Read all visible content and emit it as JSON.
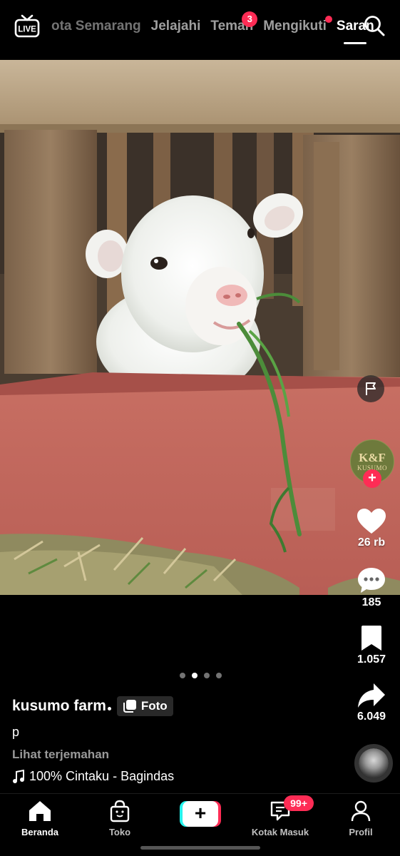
{
  "top_nav": {
    "live_label": "LIVE",
    "tabs": [
      {
        "label": "ota Semarang"
      },
      {
        "label": "Jelajahi"
      },
      {
        "label": "Teman",
        "badge": "3"
      },
      {
        "label": "Mengikuti"
      },
      {
        "label": "Saran"
      }
    ]
  },
  "rail": {
    "avatar_logo": "K&F",
    "avatar_name": "KUSUMO",
    "follow_plus": "+",
    "likes": "26 rb",
    "comments": "185",
    "bookmarks": "1.057",
    "shares": "6.049"
  },
  "caption": {
    "author": "kusumo farm",
    "type_label": "Foto",
    "description": "p",
    "translate": "Lihat terjemahan",
    "music": "100% Cintaku - Bagindas"
  },
  "carousel": {
    "total": 4,
    "active_index": 1
  },
  "bottom_bar": {
    "home": "Beranda",
    "shop": "Toko",
    "create": "+",
    "inbox": "Kotak Masuk",
    "inbox_badge": "99+",
    "profile": "Profil"
  },
  "colors": {
    "accent": "#fe2c55",
    "cyan": "#25f4ee",
    "background": "#000000"
  }
}
